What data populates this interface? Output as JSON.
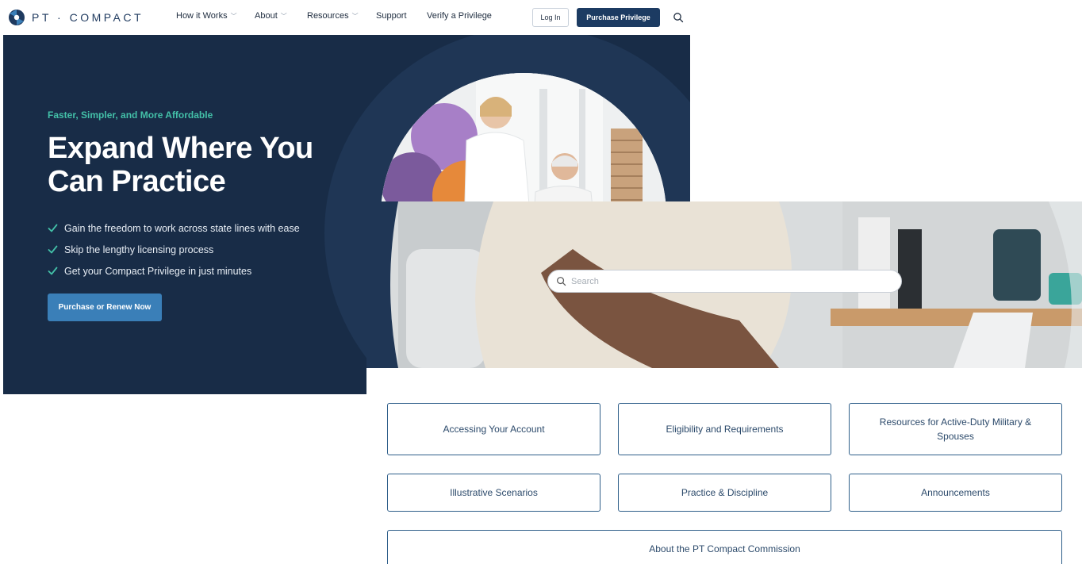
{
  "brand": {
    "logo_text": "PT · COMPACT"
  },
  "nav": {
    "items": [
      {
        "label": "How it Works",
        "has_menu": true
      },
      {
        "label": "About",
        "has_menu": true
      },
      {
        "label": "Resources",
        "has_menu": true
      },
      {
        "label": "Support",
        "has_menu": false
      },
      {
        "label": "Verify a Privilege",
        "has_menu": false
      }
    ],
    "login_label": "Log In",
    "purchase_label": "Purchase Privilege",
    "search_icon": "search-icon"
  },
  "hero": {
    "tagline": "Faster, Simpler, and More Affordable",
    "heading": "Expand Where You Can Practice",
    "bullets": [
      "Gain the freedom to work across state lines with ease",
      "Skip the lengthy licensing process",
      "Get your Compact Privilege in just minutes"
    ],
    "cta_label": "Purchase or Renew Now"
  },
  "help_center": {
    "search": {
      "placeholder": "Search",
      "value": ""
    },
    "cards": [
      {
        "label": "Accessing Your Account"
      },
      {
        "label": "Eligibility and Requirements"
      },
      {
        "label": "Resources for Active-Duty Military & Spouses"
      },
      {
        "label": "Illustrative Scenarios"
      },
      {
        "label": "Practice & Discipline"
      },
      {
        "label": "Announcements"
      },
      {
        "label": "About the PT Compact Commission"
      }
    ]
  },
  "colors": {
    "navy": "#182c47",
    "nav_button": "#1c3b62",
    "teal_accent": "#43c0a8",
    "cta_blue": "#3a7fb8",
    "card_border": "#2f5f8a"
  }
}
